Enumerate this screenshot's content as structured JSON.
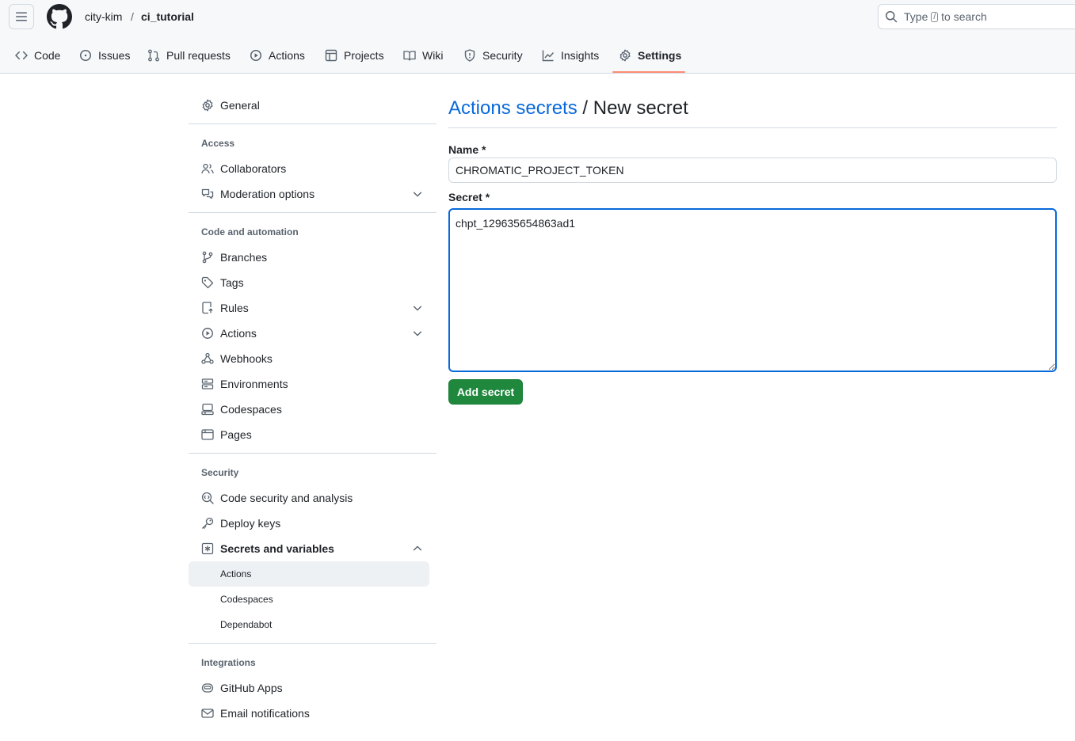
{
  "breadcrumb": {
    "owner": "city-kim",
    "separator": "/",
    "repo": "ci_tutorial"
  },
  "search": {
    "prefix": "Type",
    "key": "/",
    "suffix": "to search"
  },
  "nav": {
    "tabs": [
      {
        "label": "Code",
        "icon": "code-icon"
      },
      {
        "label": "Issues",
        "icon": "issue-icon"
      },
      {
        "label": "Pull requests",
        "icon": "pull-request-icon"
      },
      {
        "label": "Actions",
        "icon": "play-icon"
      },
      {
        "label": "Projects",
        "icon": "table-icon"
      },
      {
        "label": "Wiki",
        "icon": "book-icon"
      },
      {
        "label": "Security",
        "icon": "shield-icon"
      },
      {
        "label": "Insights",
        "icon": "graph-icon"
      },
      {
        "label": "Settings",
        "icon": "gear-icon",
        "selected": true
      }
    ]
  },
  "sidebar": {
    "general": "General",
    "access": {
      "heading": "Access",
      "items": [
        {
          "label": "Collaborators",
          "icon": "people-icon"
        },
        {
          "label": "Moderation options",
          "icon": "comment-discussion-icon",
          "expandable": true
        }
      ]
    },
    "code_automation": {
      "heading": "Code and automation",
      "items": [
        {
          "label": "Branches",
          "icon": "git-branch-icon"
        },
        {
          "label": "Tags",
          "icon": "tag-icon"
        },
        {
          "label": "Rules",
          "icon": "repo-push-icon",
          "expandable": true
        },
        {
          "label": "Actions",
          "icon": "play-icon",
          "expandable": true
        },
        {
          "label": "Webhooks",
          "icon": "webhook-icon"
        },
        {
          "label": "Environments",
          "icon": "server-icon"
        },
        {
          "label": "Codespaces",
          "icon": "codespaces-icon"
        },
        {
          "label": "Pages",
          "icon": "browser-icon"
        }
      ]
    },
    "security": {
      "heading": "Security",
      "items": [
        {
          "label": "Code security and analysis",
          "icon": "codescan-icon"
        },
        {
          "label": "Deploy keys",
          "icon": "key-icon"
        },
        {
          "label": "Secrets and variables",
          "icon": "key-asterisk-icon",
          "expanded": true
        }
      ],
      "subitems": [
        {
          "label": "Actions",
          "active": true
        },
        {
          "label": "Codespaces"
        },
        {
          "label": "Dependabot"
        }
      ]
    },
    "integrations": {
      "heading": "Integrations",
      "items": [
        {
          "label": "GitHub Apps",
          "icon": "hubot-icon"
        },
        {
          "label": "Email notifications",
          "icon": "mail-icon"
        }
      ]
    }
  },
  "main": {
    "title_link": "Actions secrets",
    "title_rest": "/ New secret",
    "name_label": "Name *",
    "name_value": "CHROMATIC_PROJECT_TOKEN",
    "secret_label": "Secret *",
    "secret_value": "chpt_129635654863ad1",
    "submit_label": "Add secret"
  },
  "colors": {
    "link": "#0969da",
    "primary_button": "#1f883d",
    "tab_underline": "#fd8c73",
    "focus_border": "#0969da"
  }
}
